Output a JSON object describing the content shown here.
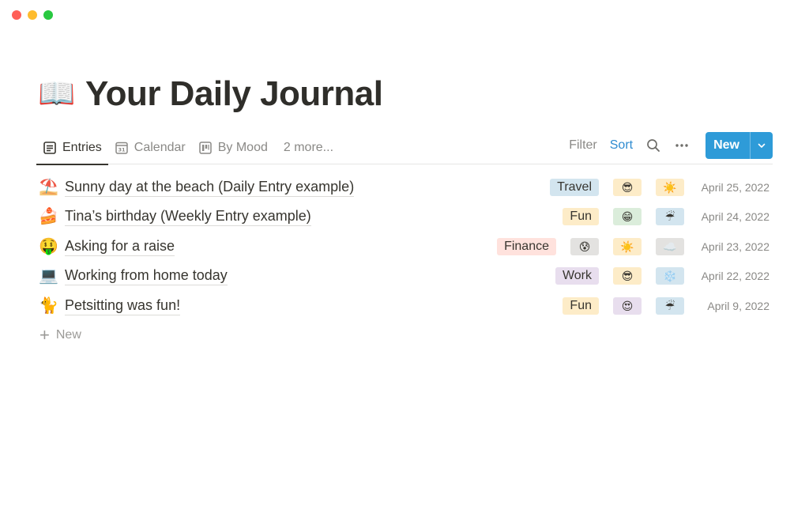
{
  "window": {
    "controls": [
      "close",
      "minimize",
      "maximize"
    ]
  },
  "page": {
    "title_emoji": "📖",
    "title": "Your Daily Journal"
  },
  "views": {
    "tabs": [
      {
        "label": "Entries",
        "icon": "list-icon",
        "active": true
      },
      {
        "label": "Calendar",
        "icon": "calendar-icon",
        "active": false
      },
      {
        "label": "By Mood",
        "icon": "board-icon",
        "active": false
      }
    ],
    "more_label": "2 more..."
  },
  "actions": {
    "filter_label": "Filter",
    "sort_label": "Sort",
    "new_label": "New"
  },
  "rows": [
    {
      "emoji": "⛱️",
      "title": "Sunny day at the beach (Daily Entry example)",
      "tag": "Travel",
      "tag_color": "#d3e5ef",
      "mood1": "😎",
      "mood1_bg": "#fdecc8",
      "mood2": "☀️",
      "mood2_bg": "#fdecc8",
      "date": "April 25, 2022"
    },
    {
      "emoji": "🍰",
      "title": "Tina’s birthday (Weekly Entry example)",
      "tag": "Fun",
      "tag_color": "#fdecc8",
      "mood1": "😁",
      "mood1_bg": "#dbeddb",
      "mood2": "☔",
      "mood2_bg": "#d3e5ef",
      "date": "April 24, 2022"
    },
    {
      "emoji": "🤑",
      "title": "Asking for a raise",
      "tag": "Finance",
      "tag_color": "#ffe2dd",
      "mood1": "😰",
      "mood1_bg": "#e3e2e0",
      "mood2": "☀️",
      "mood2_bg": "#fdecc8",
      "mood3": "☁️",
      "mood3_bg": "#e3e2e0",
      "date": "April 23, 2022"
    },
    {
      "emoji": "💻",
      "title": "Working from home today",
      "tag": "Work",
      "tag_color": "#e8deee",
      "mood1": "😎",
      "mood1_bg": "#fdecc8",
      "mood2": "❄️",
      "mood2_bg": "#d3e5ef",
      "date": "April 22, 2022"
    },
    {
      "emoji": "🐈",
      "title": "Petsitting was fun!",
      "tag": "Fun",
      "tag_color": "#fdecc8",
      "mood1": "😍",
      "mood1_bg": "#e8deee",
      "mood2": "☔",
      "mood2_bg": "#d3e5ef",
      "date": "April 9, 2022"
    }
  ],
  "add_row_label": "New"
}
